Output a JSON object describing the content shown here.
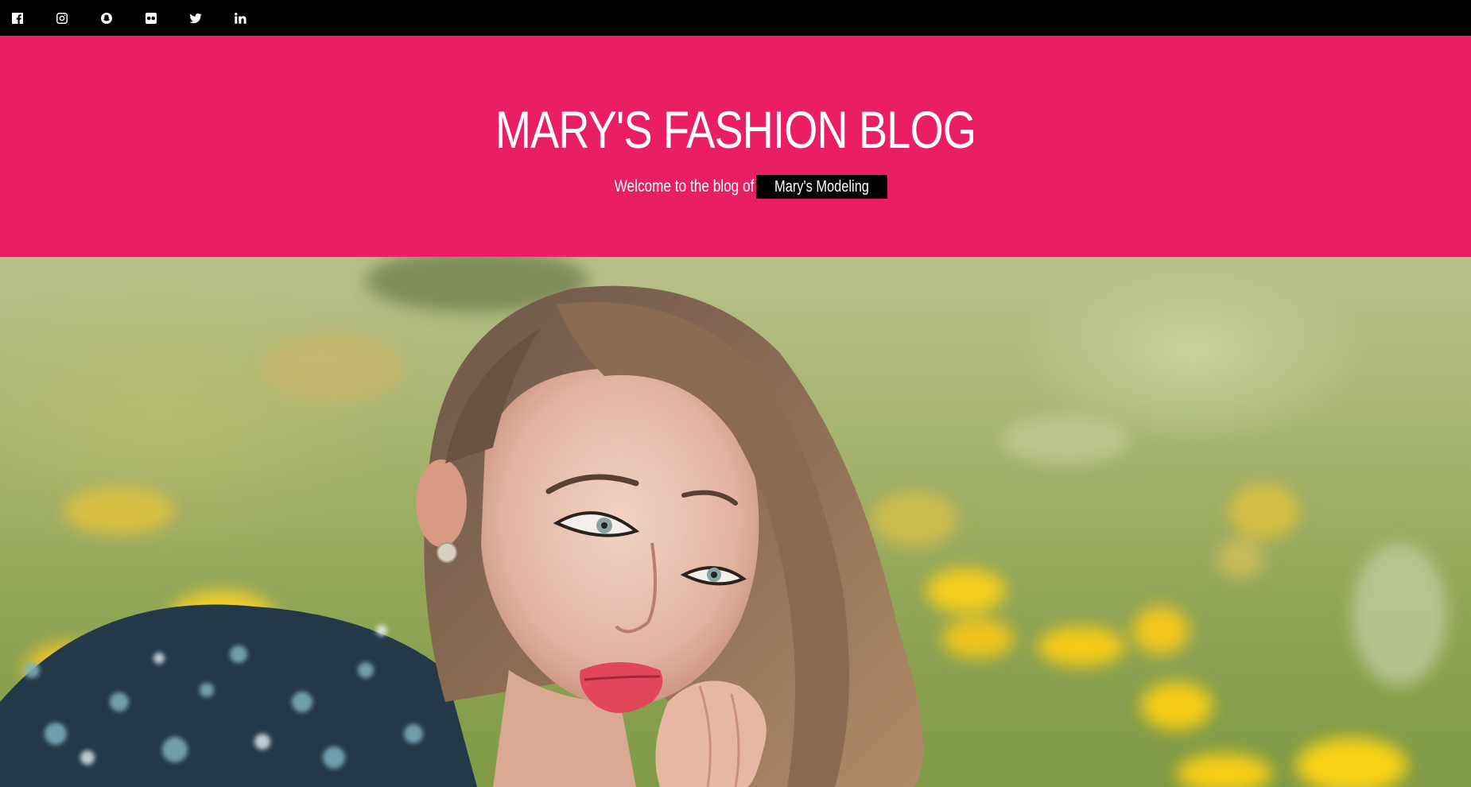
{
  "social_links": [
    {
      "icon": "facebook-icon",
      "label": "Facebook"
    },
    {
      "icon": "instagram-icon",
      "label": "Instagram"
    },
    {
      "icon": "snapchat-icon",
      "label": "Snapchat"
    },
    {
      "icon": "flickr-icon",
      "label": "Flickr"
    },
    {
      "icon": "twitter-icon",
      "label": "Twitter"
    },
    {
      "icon": "linkedin-icon",
      "label": "LinkedIn"
    }
  ],
  "header": {
    "title": "MARY'S FASHION BLOG",
    "tagline_lead": "Welcome to the blog of",
    "tagline_brand": "Mary's Modeling"
  },
  "colors": {
    "topbar": "#000000",
    "header_bg": "#e91e63",
    "brand_badge_bg": "#000000"
  },
  "hero": {
    "image": "woman-lying-in-flower-field-photo"
  }
}
